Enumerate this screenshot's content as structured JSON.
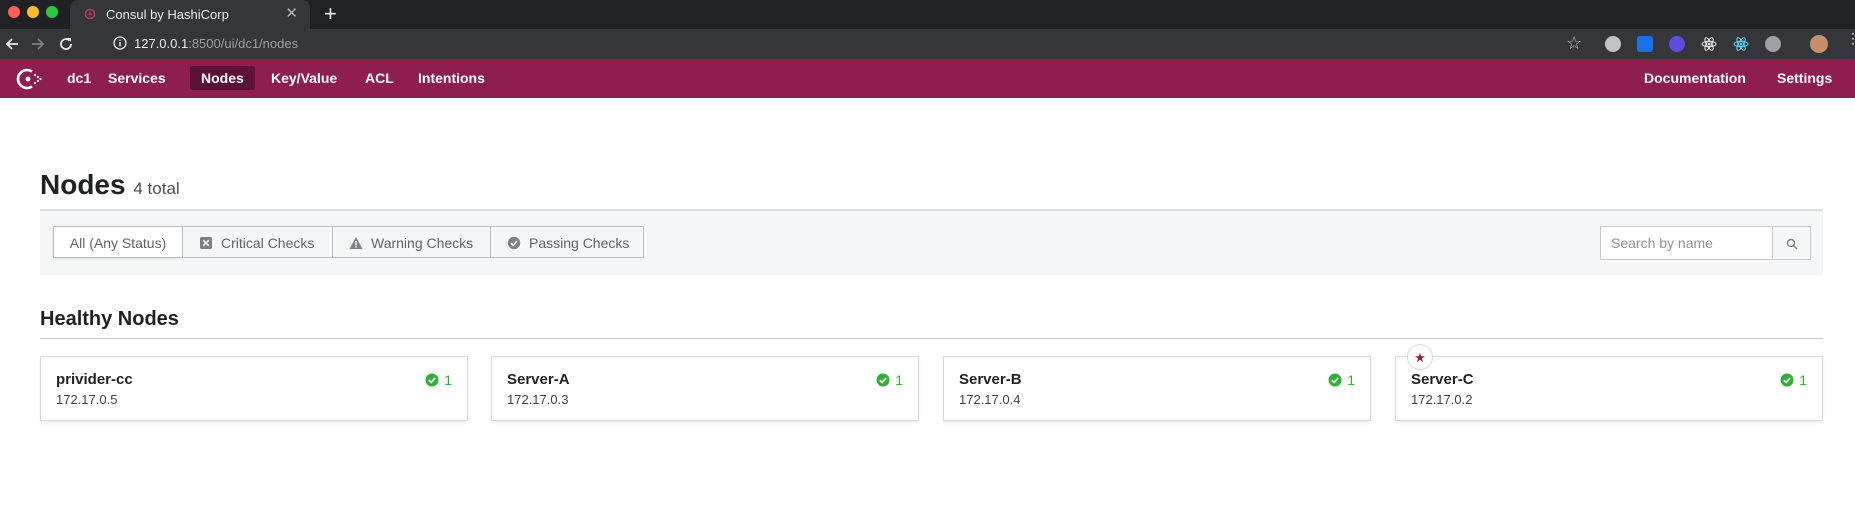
{
  "browser": {
    "tab_title": "Consul by HashiCorp",
    "url_host": "127.0.0.1",
    "url_rest": ":8500/ui/dc1/nodes"
  },
  "nav": {
    "datacenter": "dc1",
    "items": [
      "Services",
      "Nodes",
      "Key/Value",
      "ACL",
      "Intentions"
    ],
    "active": "Nodes",
    "right_items": [
      "Documentation",
      "Settings"
    ]
  },
  "page": {
    "title": "Nodes",
    "count_label": "4 total"
  },
  "filters": {
    "all": "All (Any Status)",
    "critical": "Critical Checks",
    "warning": "Warning Checks",
    "passing": "Passing Checks",
    "search_placeholder": "Search by name"
  },
  "section": {
    "title": "Healthy Nodes"
  },
  "nodes": [
    {
      "name": "privider-cc",
      "address": "172.17.0.5",
      "passing": "1",
      "leader": false
    },
    {
      "name": "Server-A",
      "address": "172.17.0.3",
      "passing": "1",
      "leader": false
    },
    {
      "name": "Server-B",
      "address": "172.17.0.4",
      "passing": "1",
      "leader": false
    },
    {
      "name": "Server-C",
      "address": "172.17.0.2",
      "passing": "1",
      "leader": true
    }
  ],
  "colors": {
    "brand": "#8e1e4d",
    "brand_active": "#5c1233",
    "passing": "#2eb039"
  },
  "icons": {
    "leader": "star-icon",
    "passing": "check-circle-icon",
    "critical": "x-square-icon",
    "warning": "warning-triangle-icon",
    "search": "search-icon"
  }
}
